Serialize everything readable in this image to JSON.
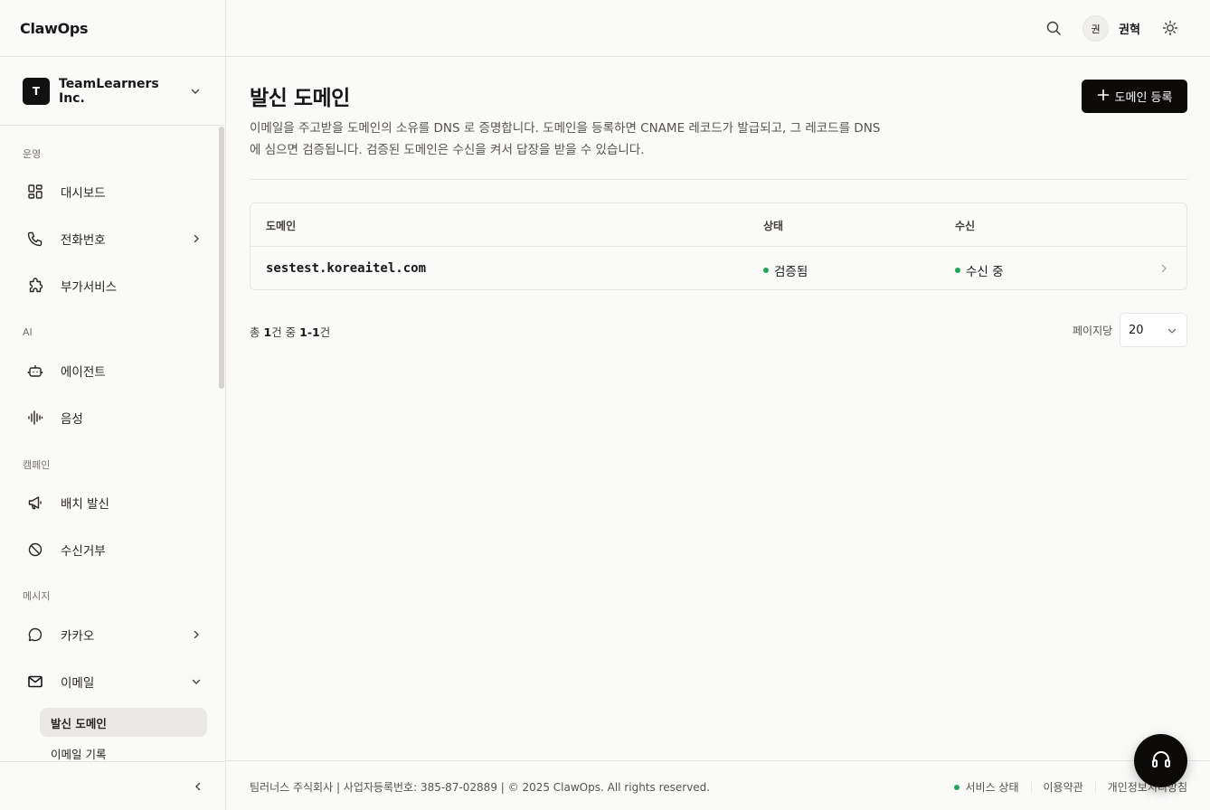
{
  "brand": "ClawOps",
  "org": {
    "avatar": "T",
    "name": "TeamLearners Inc."
  },
  "sidebar": {
    "sections": {
      "ops": "운영",
      "ai": "AI",
      "campaign": "캠페인",
      "message": "메시지"
    },
    "items": {
      "dashboard": "대시보드",
      "phone": "전화번호",
      "addon": "부가서비스",
      "agent": "에이전트",
      "voice": "음성",
      "batch": "배치 발신",
      "block": "수신거부",
      "kakao": "카카오",
      "email": "이메일"
    },
    "sub": {
      "sender_domain": "발신 도메인",
      "email_log": "이메일 기록"
    }
  },
  "header": {
    "avatar": "권",
    "user": "권혁"
  },
  "page": {
    "title": "발신 도메인",
    "desc": "이메일을 주고받을 도메인의 소유를 DNS 로 증명합니다. 도메인을 등록하면 CNAME 레코드가 발급되고, 그 레코드를 DNS 에 심으면 검증됩니다. 검증된 도메인은 수신을 켜서 답장을 받을 수 있습니다.",
    "add_button": "도메인 등록"
  },
  "table": {
    "headers": {
      "domain": "도메인",
      "status": "상태",
      "receive": "수신"
    },
    "rows": [
      {
        "domain": "sestest.koreaitel.com",
        "status": "검증됨",
        "receive": "수신 중"
      }
    ]
  },
  "pager": {
    "prefix": "총",
    "total": "1",
    "mid": "건 중",
    "range": "1-1",
    "suffix": "건",
    "per_page_label": "페이지당",
    "per_page": "20"
  },
  "footer": {
    "copy": "팀러너스 주식회사 | 사업자등록번호: 385-87-02889 | © 2025 ClawOps. All rights reserved.",
    "status": "서비스 상태",
    "terms": "이용약관",
    "privacy": "개인정보처리방침"
  },
  "colors": {
    "accent": "#0c0a09",
    "ok": "#22a55b",
    "bg": "#fafaf9"
  }
}
